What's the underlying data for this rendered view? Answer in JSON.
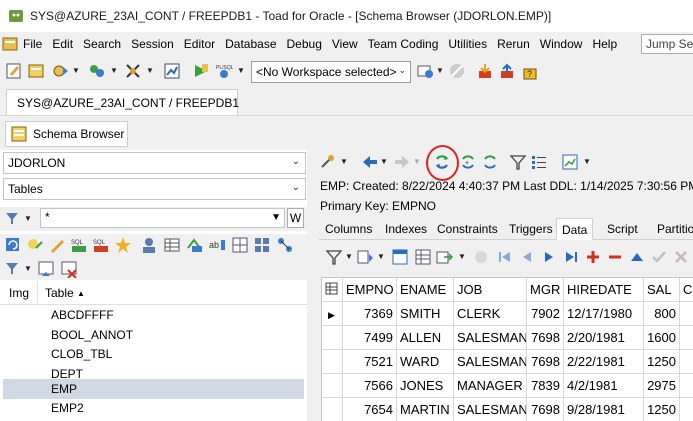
{
  "window": {
    "title": "SYS@AZURE_23AI_CONT / FREEPDB1 - Toad for Oracle - [Schema Browser (JDORLON.EMP)]"
  },
  "menu": {
    "items": [
      "File",
      "Edit",
      "Search",
      "Session",
      "Editor",
      "Database",
      "Debug",
      "View",
      "Team Coding",
      "Utilities",
      "Rerun",
      "Window",
      "Help"
    ],
    "jump_search": "Jump Sea"
  },
  "toolbar": {
    "workspace": "<No Workspace selected>"
  },
  "connection_tab": {
    "label": "SYS@AZURE_23AI_CONT / FREEPDB1"
  },
  "schema_browser_tab": {
    "label": "Schema Browser"
  },
  "left_panel": {
    "schema": "JDORLON",
    "object_type": "Tables",
    "filter": "*",
    "w_button": "W",
    "columns": [
      "Img",
      "Table"
    ],
    "tables": [
      "ABCDFFFF",
      "BOOL_ANNOT",
      "CLOB_TBL",
      "DEPT",
      "EMP",
      "EMP2"
    ],
    "selected_table": "EMP"
  },
  "right_panel": {
    "info_line1": "EMP:  Created: 8/22/2024 4:40:37 PM   Last DDL: 1/14/2025 7:30:56 PM",
    "info_line2": "Primary Key:  EMPNO",
    "tabs": [
      "Columns",
      "Indexes",
      "Constraints",
      "Triggers",
      "Data",
      "Script",
      "Partitio"
    ],
    "active_tab": "Data",
    "grid": {
      "headers": [
        "EMPNO",
        "ENAME",
        "JOB",
        "MGR",
        "HIREDATE",
        "SAL",
        "C"
      ],
      "rows": [
        [
          "7369",
          "SMITH",
          "CLERK",
          "7902",
          "12/17/1980",
          "800"
        ],
        [
          "7499",
          "ALLEN",
          "SALESMAN",
          "7698",
          "2/20/1981",
          "1600"
        ],
        [
          "7521",
          "WARD",
          "SALESMAN",
          "7698",
          "2/22/1981",
          "1250"
        ],
        [
          "7566",
          "JONES",
          "MANAGER",
          "7839",
          "4/2/1981",
          "2975"
        ],
        [
          "7654",
          "MARTIN",
          "SALESMAN",
          "7698",
          "9/28/1981",
          "1250"
        ]
      ]
    }
  },
  "colors": {
    "highlight": "#e02020",
    "selection": "#cfd8e3",
    "nav_blue": "#2a6ab8",
    "add_red": "#d03020",
    "refresh_green": "#2a9a3a"
  }
}
